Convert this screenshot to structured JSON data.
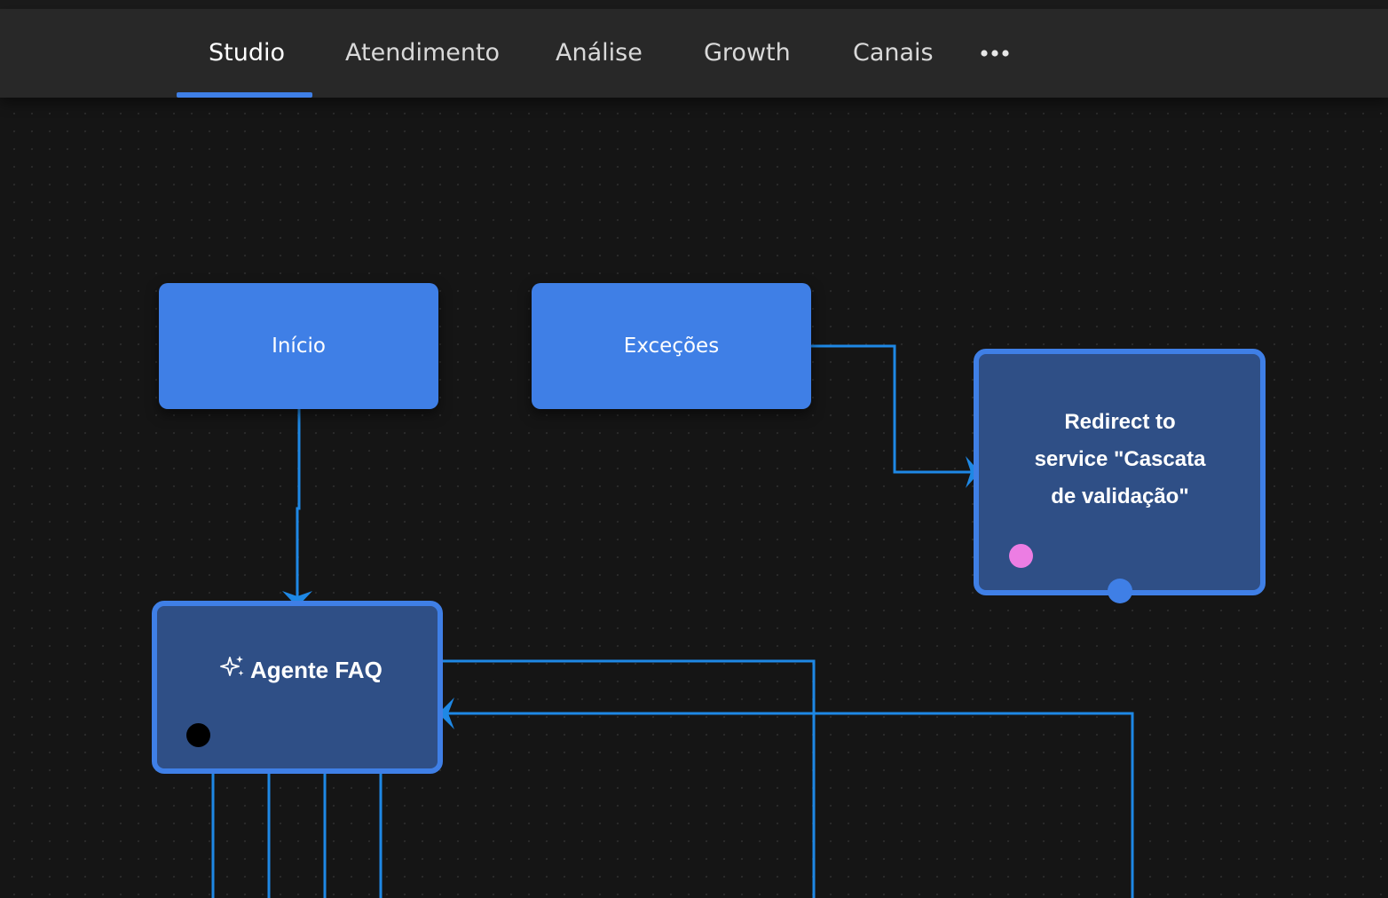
{
  "nav": {
    "tabs": [
      {
        "label": "Studio",
        "active": true
      },
      {
        "label": "Atendimento"
      },
      {
        "label": "Análise"
      },
      {
        "label": "Growth"
      },
      {
        "label": "Canais"
      }
    ],
    "more_icon": "ellipsis-icon"
  },
  "flow": {
    "nodes": {
      "inicio": {
        "label": "Início"
      },
      "excecoes": {
        "label": "Exceções"
      },
      "redirect": {
        "label": "Redirect to service \"Cascata de validação\""
      },
      "agente": {
        "label": "Agente FAQ",
        "icon": "sparkles-icon"
      }
    },
    "colors": {
      "node": "#3f7fe6",
      "node_fill": "#2f4f86",
      "edge": "#1e88e5",
      "redirect_marker": "#ec7de3",
      "agent_marker": "#000000"
    }
  }
}
